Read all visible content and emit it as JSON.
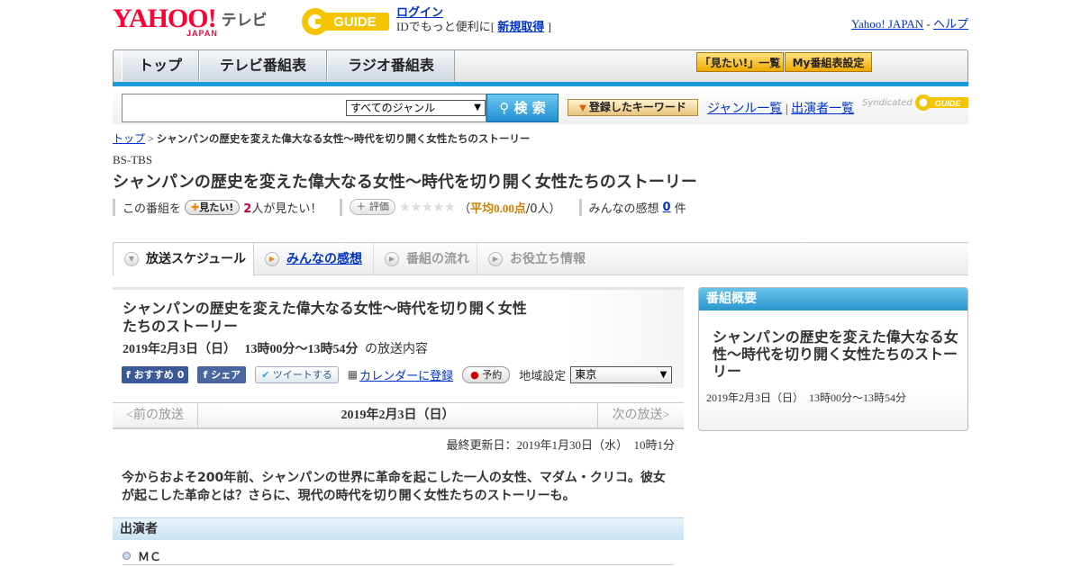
{
  "header": {
    "logo_yahoo": "YAHOO!",
    "logo_japan": "JAPAN",
    "logo_tv": "テレビ",
    "gguide_text": "GUIDE",
    "login": "ログイン",
    "login_note_prefix": "IDでもっと便利に[",
    "signup": "新規取得",
    "login_note_suffix": "]",
    "yahoo_japan_link": "Yahoo! JAPAN",
    "separator": "-",
    "help_link": "ヘルプ"
  },
  "nav": {
    "tabs": [
      "トップ",
      "テレビ番組表",
      "ラジオ番組表"
    ],
    "mitai_list": "「見たい!」一覧",
    "my_schedule": "My番組表設定"
  },
  "search": {
    "genre": "すべてのジャンル",
    "button": "検 索",
    "keyword_button": "登録したキーワード",
    "genre_list": "ジャンル一覧",
    "divider": "|",
    "cast_list": "出演者一覧",
    "syndicated": "Syndicated"
  },
  "breadcrumb": {
    "home": "トップ",
    "sep": " > ",
    "current": "シャンパンの歴史を変えた偉大なる女性～時代を切り開く女性たちのストーリー"
  },
  "program": {
    "channel": "BS-TBS",
    "title": "シャンパンの歴史を変えた偉大なる女性～時代を切り開く女性たちのストーリー",
    "this_program": "この番組を",
    "mitai_btn": "見たい!",
    "watchers_count": "2",
    "watchers_suffix": "人が見たい！",
    "rate_btn": "評価",
    "stars": "★★★★★",
    "avg_open": "（",
    "avg_value": "平均0.00点",
    "avg_close": "/0人）",
    "impressions_label": "みんなの感想",
    "impressions_count": "0",
    "impressions_suffix": "件"
  },
  "tabs": {
    "schedule": "放送スケジュール",
    "impressions": "みんなの感想",
    "flow": "番組の流れ",
    "info": "お役立ち情報"
  },
  "broadcast": {
    "title": "シャンパンの歴史を変えた偉大なる女性～時代を切り開く女性たちのストーリー",
    "date": "2019年2月3日（日）",
    "time": "13時00分～13時54分",
    "date_suffix": "の放送内容",
    "fb_recommend": "おすすめ",
    "fb_count": "0",
    "fb_share": "シェア",
    "tweet": "ツイートする",
    "calendar": "カレンダーに登録",
    "reserve": "予約",
    "region_label": "地域設定",
    "region": "東京",
    "prev": "<前の放送",
    "current_date": "2019年2月3日（日）",
    "next": "次の放送>",
    "updated": "最終更新日：2019年1月30日（水）　10時1分",
    "description": "今からおよそ200年前、シャンパンの世界に革命を起こした一人の女性、マダム・クリコ。彼女が起こした革命とは？さらに、現代の時代を切り開く女性たちのストーリーも。",
    "cast_header": "出演者",
    "cast_role": "ＭＣ"
  },
  "sidebar": {
    "header": "番組概要",
    "title": "シャンパンの歴史を変えた偉大なる女性～時代を切り開く女性たちのストーリー",
    "datetime": "2019年2月3日（日）　13時00分～13時54分"
  }
}
